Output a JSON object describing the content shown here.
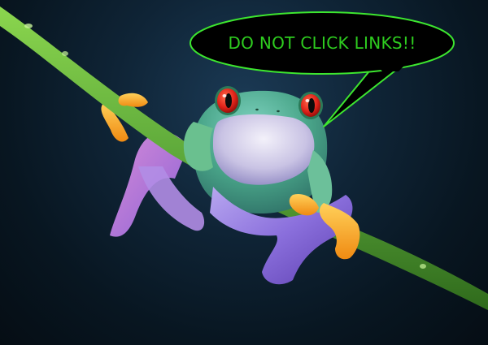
{
  "speech_bubble": {
    "text": "DO NOT CLICK LINKS!!",
    "text_color": "#2ecc1f",
    "fill_color": "#000000",
    "outline_color": "#3de62f"
  },
  "colors": {
    "background": "#0c1e2c",
    "stem": "#5da83a",
    "frog_body": "#54b58a",
    "frog_belly": "#d9d4e8",
    "frog_legs": "#8a74d6",
    "frog_toes": "#f4a21d",
    "frog_eyes": "#e8231b"
  }
}
